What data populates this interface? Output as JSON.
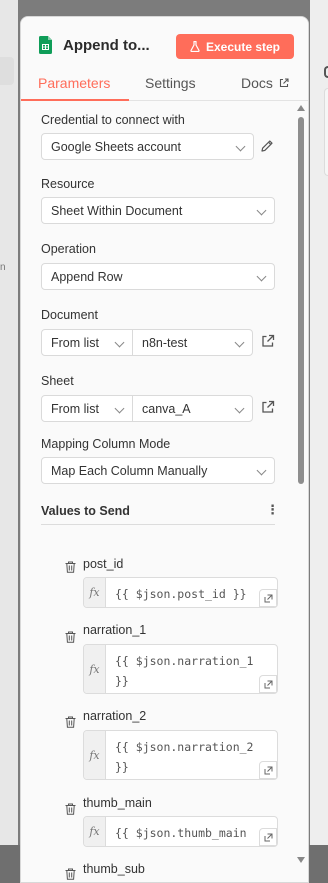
{
  "node": {
    "title": "Append to...",
    "execute_label": "Execute step"
  },
  "tabs": [
    {
      "label": "Parameters",
      "active": true
    },
    {
      "label": "Settings",
      "active": false
    },
    {
      "label": "Docs",
      "active": false
    }
  ],
  "credential": {
    "label": "Credential to connect with",
    "value": "Google Sheets account"
  },
  "resource": {
    "label": "Resource",
    "value": "Sheet Within Document"
  },
  "operation": {
    "label": "Operation",
    "value": "Append Row"
  },
  "document": {
    "label": "Document",
    "mode": "From list",
    "value": "n8n-test"
  },
  "sheet": {
    "label": "Sheet",
    "mode": "From list",
    "value": "canva_A"
  },
  "mapping": {
    "label": "Mapping Column Mode",
    "value": "Map Each Column Manually"
  },
  "values_to_send": {
    "title": "Values to Send",
    "fields": [
      {
        "name": "post_id",
        "expression": "{{ $json.post_id }}"
      },
      {
        "name": "narration_1",
        "expression": "{{ $json.narration_1\n}}"
      },
      {
        "name": "narration_2",
        "expression": "{{ $json.narration_2\n}}"
      },
      {
        "name": "thumb_main",
        "expression": "{{ $json.thumb_main"
      },
      {
        "name": "thumb_sub",
        "expression": ""
      }
    ]
  },
  "colors": {
    "accent": "#ff6d5a",
    "sheets_green": "#0f9d58"
  }
}
